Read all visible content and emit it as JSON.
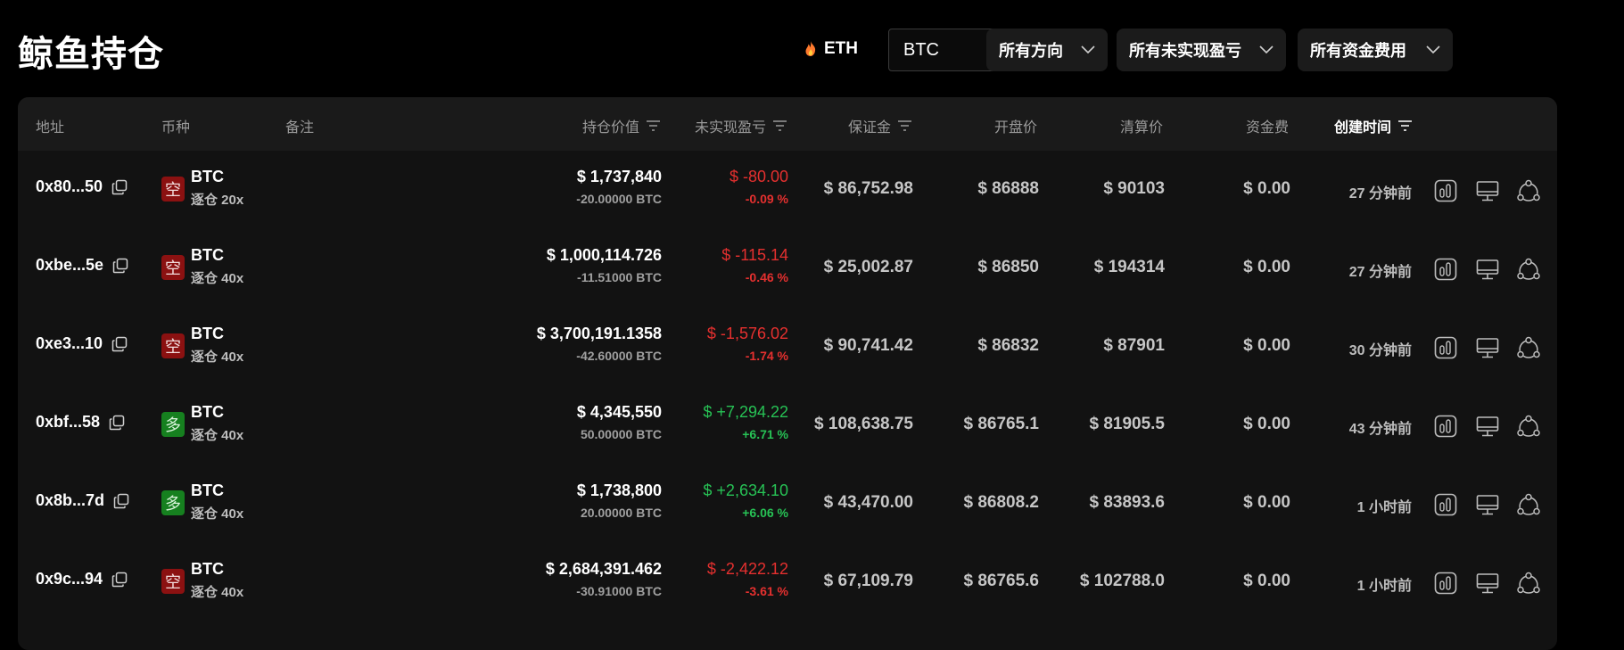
{
  "page_title": "鲸鱼持仓",
  "eth_label": "ETH",
  "coin_select": "BTC",
  "filters": {
    "direction": "所有方向",
    "pnl": "所有未实现盈亏",
    "funding": "所有资金费用"
  },
  "columns": {
    "address": "地址",
    "coin": "币种",
    "note": "备注",
    "position_value": "持仓价值",
    "unrealized_pnl": "未实现盈亏",
    "margin": "保证金",
    "open_price": "开盘价",
    "liq_price": "清算价",
    "funding": "资金费",
    "created": "创建时间"
  },
  "colors": {
    "short_badge": "#8b1111",
    "long_badge": "#16801f",
    "loss": "#e5302f",
    "profit": "#27c255"
  },
  "icons": [
    "copy-icon",
    "flame-icon",
    "chevron-down-icon",
    "sort-icon",
    "chart-icon",
    "monitor-icon",
    "share-icon"
  ],
  "rows": [
    {
      "address": "0x80...50",
      "side": "空",
      "side_type": "short",
      "coin": "BTC",
      "leverage": "逐仓 20x",
      "value": "$ 1,737,840",
      "size": "-20.00000 BTC",
      "pnl": "$ -80.00",
      "pnl_pct": "-0.09 %",
      "pnl_type": "loss",
      "margin": "$ 86,752.98",
      "open": "$ 86888",
      "liq": "$ 90103",
      "funding": "$ 0.00",
      "time": "27 分钟前"
    },
    {
      "address": "0xbe...5e",
      "side": "空",
      "side_type": "short",
      "coin": "BTC",
      "leverage": "逐仓 40x",
      "value": "$ 1,000,114.726",
      "size": "-11.51000 BTC",
      "pnl": "$ -115.14",
      "pnl_pct": "-0.46 %",
      "pnl_type": "loss",
      "margin": "$ 25,002.87",
      "open": "$ 86850",
      "liq": "$ 194314",
      "funding": "$ 0.00",
      "time": "27 分钟前"
    },
    {
      "address": "0xe3...10",
      "side": "空",
      "side_type": "short",
      "coin": "BTC",
      "leverage": "逐仓 40x",
      "value": "$ 3,700,191.1358",
      "size": "-42.60000 BTC",
      "pnl": "$ -1,576.02",
      "pnl_pct": "-1.74 %",
      "pnl_type": "loss",
      "margin": "$ 90,741.42",
      "open": "$ 86832",
      "liq": "$ 87901",
      "funding": "$ 0.00",
      "time": "30 分钟前"
    },
    {
      "address": "0xbf...58",
      "side": "多",
      "side_type": "long",
      "coin": "BTC",
      "leverage": "逐仓 40x",
      "value": "$ 4,345,550",
      "size": "50.00000 BTC",
      "pnl": "$ +7,294.22",
      "pnl_pct": "+6.71 %",
      "pnl_type": "profit",
      "margin": "$ 108,638.75",
      "open": "$ 86765.1",
      "liq": "$ 81905.5",
      "funding": "$ 0.00",
      "time": "43 分钟前"
    },
    {
      "address": "0x8b...7d",
      "side": "多",
      "side_type": "long",
      "coin": "BTC",
      "leverage": "逐仓 40x",
      "value": "$ 1,738,800",
      "size": "20.00000 BTC",
      "pnl": "$ +2,634.10",
      "pnl_pct": "+6.06 %",
      "pnl_type": "profit",
      "margin": "$ 43,470.00",
      "open": "$ 86808.2",
      "liq": "$ 83893.6",
      "funding": "$ 0.00",
      "time": "1 小时前"
    },
    {
      "address": "0x9c...94",
      "side": "空",
      "side_type": "short",
      "coin": "BTC",
      "leverage": "逐仓 40x",
      "value": "$ 2,684,391.462",
      "size": "-30.91000 BTC",
      "pnl": "$ -2,422.12",
      "pnl_pct": "-3.61 %",
      "pnl_type": "loss",
      "margin": "$ 67,109.79",
      "open": "$ 86765.6",
      "liq": "$ 102788.0",
      "funding": "$ 0.00",
      "time": "1 小时前"
    }
  ]
}
